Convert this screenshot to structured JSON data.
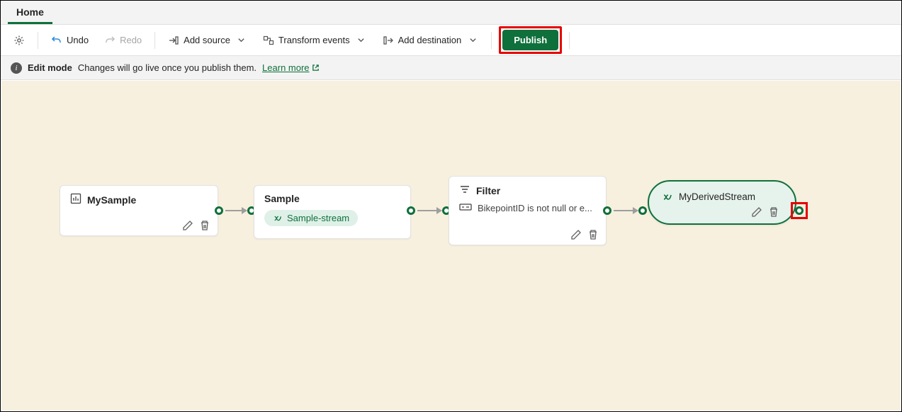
{
  "tabs": {
    "home": "Home"
  },
  "toolbar": {
    "undo": "Undo",
    "redo": "Redo",
    "add_source": "Add source",
    "transform": "Transform events",
    "add_dest": "Add destination",
    "publish": "Publish"
  },
  "infobar": {
    "mode": "Edit mode",
    "msg": "Changes will go live once you publish them.",
    "learn": "Learn more"
  },
  "nodes": {
    "source": {
      "title": "MySample"
    },
    "sample": {
      "title": "Sample",
      "chip": "Sample-stream"
    },
    "filter": {
      "title": "Filter",
      "expr": "BikepointID is not null or e..."
    },
    "dest": {
      "title": "MyDerivedStream"
    }
  }
}
